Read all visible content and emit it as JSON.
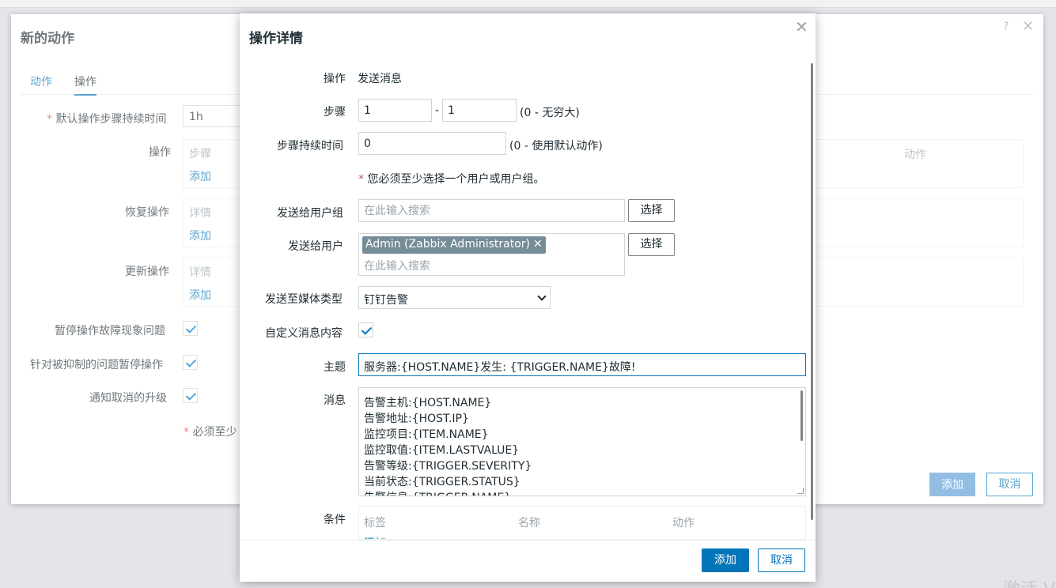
{
  "background": {
    "title": "新的动作",
    "help": "?",
    "tabs": [
      "动作",
      "操作"
    ],
    "fields": {
      "default_step_duration_label": "默认操作步骤持续时间",
      "default_step_duration_value": "1h",
      "operations_label": "操作",
      "operations_header": "步骤",
      "operations_add": "添加",
      "recovery_label": "恢复操作",
      "recovery_header": "详情",
      "recovery_add": "添加",
      "update_label": "更新操作",
      "update_header": "详情",
      "update_add": "添加",
      "pause_problem_label": "暂停操作故障现象问题",
      "pause_suppressed_label": "针对被抑制的问题暂停操作",
      "notify_cancel_label": "通知取消的升级",
      "note": "必须至少",
      "actions_col": "动作"
    },
    "buttons": {
      "add": "添加",
      "cancel": "取消"
    },
    "watermark": "激活 V"
  },
  "dialog": {
    "title": "操作详情",
    "operation_label": "操作",
    "operation_value": "发送消息",
    "steps_label": "步骤",
    "step_from": "1",
    "step_sep": "-",
    "step_to": "1",
    "steps_hint": "(0 - 无穷大)",
    "step_duration_label": "步骤持续时间",
    "step_duration_value": "0",
    "step_duration_hint": "(0 - 使用默认动作)",
    "required_note": "您必须至少选择一个用户或用户组。",
    "send_groups_label": "发送给用户组",
    "send_groups_placeholder": "在此输入搜索",
    "select_label": "选择",
    "send_users_label": "发送给用户",
    "user_chip": "Admin (Zabbix Administrator)",
    "send_users_placeholder": "在此输入搜索",
    "media_label": "发送至媒体类型",
    "media_value": "钉钉告警",
    "custom_msg_label": "自定义消息内容",
    "subject_label": "主题",
    "subject_value": "服务器:{HOST.NAME}发生: {TRIGGER.NAME}故障!",
    "message_label": "消息",
    "message_lines": [
      "告警主机:{HOST.NAME}",
      "告警地址:{HOST.IP}",
      "监控项目:{ITEM.NAME}",
      "监控取值:{ITEM.LASTVALUE}",
      "告警等级:{TRIGGER.SEVERITY}",
      "当前状态:{TRIGGER.STATUS}",
      "告警信息:{TRIGGER.NAME}"
    ],
    "conditions_label": "条件",
    "conditions_headers": [
      "标签",
      "名称",
      "动作"
    ],
    "conditions_add": "添加",
    "add_button": "添加",
    "cancel_button": "取消"
  },
  "colors": {
    "accent": "#0275b8",
    "required": "#d64e4e",
    "chip": "#768d99"
  }
}
